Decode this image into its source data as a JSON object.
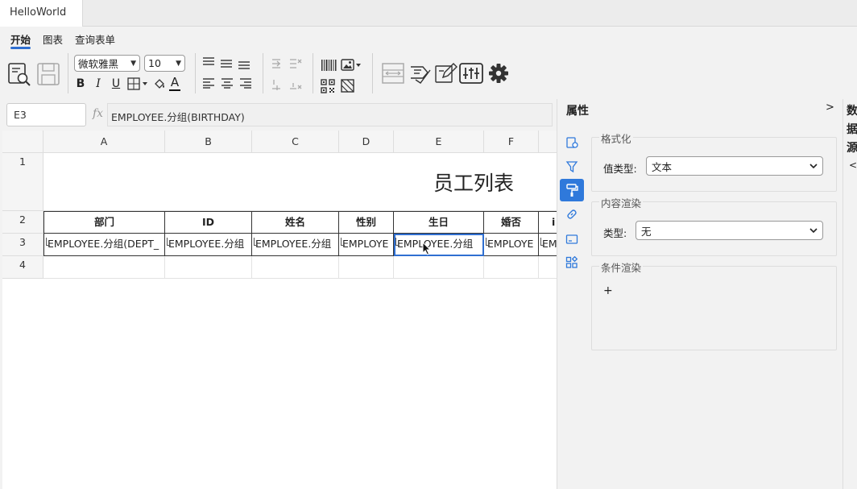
{
  "window": {
    "doc_tab": "HelloWorld"
  },
  "menu": {
    "start": "开始",
    "chart": "图表",
    "query": "查询表单"
  },
  "toolbar": {
    "font_family": "微软雅黑",
    "font_size": "10",
    "bold": "B",
    "italic": "I",
    "underline": "U",
    "font_color": "A"
  },
  "formula_bar": {
    "cell_ref": "E3",
    "fx": "fx",
    "formula": "EMPLOYEE.分组(BIRTHDAY)"
  },
  "grid": {
    "columns": [
      "A",
      "B",
      "C",
      "D",
      "E",
      "F",
      ""
    ],
    "rows": [
      "1",
      "2",
      "3",
      "4"
    ],
    "title": "员工列表",
    "headers": [
      "部门",
      "ID",
      "姓名",
      "性别",
      "生日",
      "婚否",
      "i"
    ],
    "cells": [
      "EMPLOYEE.分组(DEPT_",
      "EMPLOYEE.分组",
      "EMPLOYEE.分组",
      "EMPLOYE",
      "EMPLOYEE.分组",
      "EMPLOYE",
      "EM"
    ]
  },
  "properties": {
    "title": "属性",
    "collapse": ">",
    "format_group": "格式化",
    "value_type_label": "值类型:",
    "value_type_value": "文本",
    "render_group": "内容渲染",
    "type_label": "类型:",
    "type_value": "无",
    "cond_group": "条件渲染",
    "add": "+"
  },
  "datasource": {
    "title": "数据源",
    "expand": "<"
  },
  "colors": {
    "accent": "#2f79db",
    "tab_underline": "#2f6fd1",
    "selection": "#2f6fd1"
  }
}
